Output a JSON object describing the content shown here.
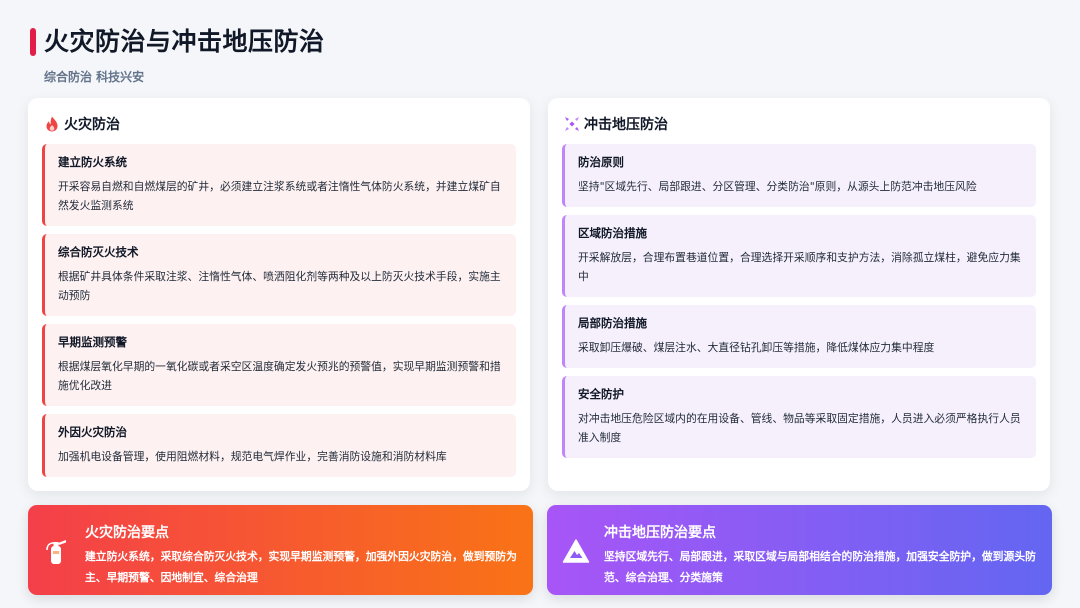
{
  "header": {
    "title": "火灾防治与冲击地压防治",
    "subtitle": "综合防治 科技兴安"
  },
  "fire_panel": {
    "title": "火灾防治",
    "icon": "flame-icon",
    "items": [
      {
        "title": "建立防火系统",
        "text": "开采容易自燃和自燃煤层的矿井，必须建立注浆系统或者注惰性气体防火系统，并建立煤矿自然发火监测系统"
      },
      {
        "title": "综合防灭火技术",
        "text": "根据矿井具体条件采取注浆、注惰性气体、喷洒阻化剂等两种及以上防灭火技术手段，实施主动预防"
      },
      {
        "title": "早期监测预警",
        "text": "根据煤层氧化早期的一氧化碳或者采空区温度确定发火预兆的预警值，实现早期监测预警和措施优化改进"
      },
      {
        "title": "外因火灾防治",
        "text": "加强机电设备管理，使用阻燃材料，规范电气焊作业，完善消防设施和消防材料库"
      }
    ]
  },
  "rock_panel": {
    "title": "冲击地压防治",
    "icon": "burst-icon",
    "items": [
      {
        "title": "防治原则",
        "text": "坚持\"区域先行、局部跟进、分区管理、分类防治\"原则，从源头上防范冲击地压风险"
      },
      {
        "title": "区域防治措施",
        "text": "开采解放层，合理布置巷道位置，合理选择开采顺序和支护方法，消除孤立煤柱，避免应力集中"
      },
      {
        "title": "局部防治措施",
        "text": "采取卸压爆破、煤层注水、大直径钻孔卸压等措施，降低煤体应力集中程度"
      },
      {
        "title": "安全防护",
        "text": "对冲击地压危险区域内的在用设备、管线、物品等采取固定措施，人员进入必须严格执行人员准入制度"
      }
    ]
  },
  "summaries": {
    "fire": {
      "title": "火灾防治要点",
      "icon": "fire-extinguisher-icon",
      "text": "建立防火系统，采取综合防灭火技术，实现早期监测预警，加强外因火灾防治，做到预防为主、早期预警、因地制宜、综合治理"
    },
    "rock": {
      "title": "冲击地压防治要点",
      "icon": "warning-triangle-icon",
      "text": "坚持区域先行、局部跟进，采取区域与局部相结合的防治措施，加强安全防护，做到源头防范、综合治理、分类施策"
    }
  },
  "colors": {
    "accent_red": "#e11d48",
    "fire_border": "#ef4444",
    "rock_border": "#c084fc",
    "fire_gradient": [
      "#f43f4a",
      "#f97316"
    ],
    "rock_gradient": [
      "#a855f7",
      "#6366f1"
    ]
  }
}
